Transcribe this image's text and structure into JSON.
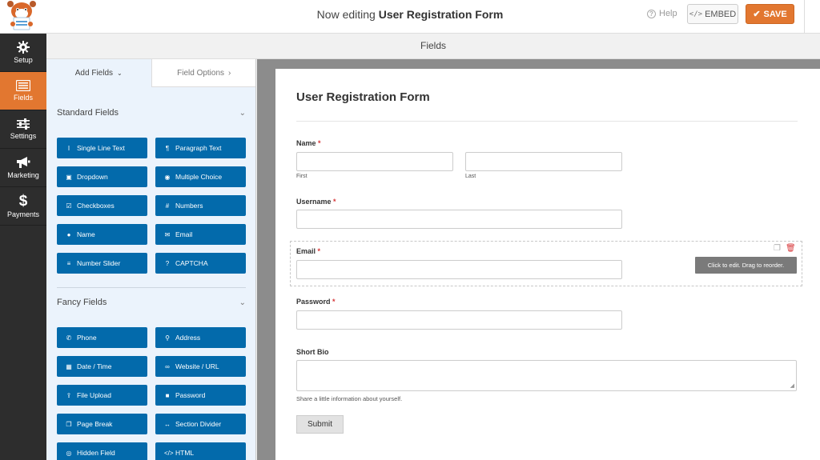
{
  "header": {
    "prefix": "Now editing",
    "form_name": "User Registration Form",
    "help_label": "Help",
    "embed_label": "EMBED",
    "save_label": "SAVE",
    "accent": "#e27730"
  },
  "nav": [
    {
      "label": "Setup",
      "icon": "gear-icon"
    },
    {
      "label": "Fields",
      "icon": "fields-icon",
      "active": true
    },
    {
      "label": "Settings",
      "icon": "sliders-icon"
    },
    {
      "label": "Marketing",
      "icon": "megaphone-icon"
    },
    {
      "label": "Payments",
      "icon": "dollar-icon"
    }
  ],
  "section_title": "Fields",
  "panel": {
    "tab_add": "Add Fields",
    "tab_options": "Field Options",
    "standard_title": "Standard Fields",
    "standard": [
      {
        "label": "Single Line Text",
        "icon": "text-cursor-icon"
      },
      {
        "label": "Paragraph Text",
        "icon": "paragraph-icon"
      },
      {
        "label": "Dropdown",
        "icon": "dropdown-icon"
      },
      {
        "label": "Multiple Choice",
        "icon": "radio-icon"
      },
      {
        "label": "Checkboxes",
        "icon": "checkbox-icon"
      },
      {
        "label": "Numbers",
        "icon": "hash-icon"
      },
      {
        "label": "Name",
        "icon": "user-icon"
      },
      {
        "label": "Email",
        "icon": "envelope-icon"
      },
      {
        "label": "Number Slider",
        "icon": "slider-icon"
      },
      {
        "label": "CAPTCHA",
        "icon": "question-icon"
      }
    ],
    "fancy_title": "Fancy Fields",
    "fancy": [
      {
        "label": "Phone",
        "icon": "phone-icon"
      },
      {
        "label": "Address",
        "icon": "map-pin-icon"
      },
      {
        "label": "Date / Time",
        "icon": "calendar-icon"
      },
      {
        "label": "Website / URL",
        "icon": "link-icon"
      },
      {
        "label": "File Upload",
        "icon": "upload-icon"
      },
      {
        "label": "Password",
        "icon": "lock-icon"
      },
      {
        "label": "Page Break",
        "icon": "copy-icon"
      },
      {
        "label": "Section Divider",
        "icon": "arrows-h-icon"
      },
      {
        "label": "Hidden Field",
        "icon": "eye-slash-icon"
      },
      {
        "label": "HTML",
        "icon": "code-icon"
      }
    ]
  },
  "form": {
    "title": "User Registration Form",
    "name_label": "Name",
    "first_label": "First",
    "last_label": "Last",
    "username_label": "Username",
    "email_label": "Email",
    "password_label": "Password",
    "bio_label": "Short Bio",
    "bio_description": "Share a little information about yourself.",
    "required_mark": "*",
    "tooltip": "Click to edit. Drag to reorder.",
    "submit_label": "Submit"
  }
}
